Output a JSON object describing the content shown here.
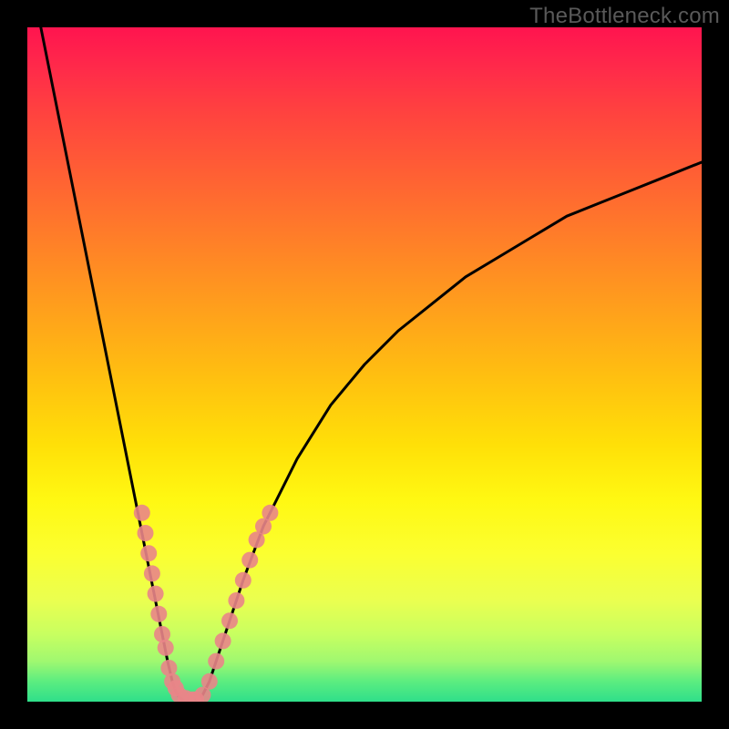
{
  "attribution": "TheBottleneck.com",
  "colors": {
    "frame": "#000000",
    "curve": "#000000",
    "markers": "#e98588",
    "gradient_top": "#ff144f",
    "gradient_bottom": "#2fdf8a"
  },
  "chart_data": {
    "type": "line",
    "title": "",
    "xlabel": "",
    "ylabel": "",
    "xlim": [
      0,
      100
    ],
    "ylim": [
      0,
      100
    ],
    "grid": false,
    "note": "V-shaped bottleneck curve; left branch falls steeply from y≈100 at x≈2 to x≈22,y≈0; right branch rises with decreasing slope from x≈25,y≈0 toward x≈100,y≈80. Marker clusters sit near the trough of the V at roughly y 0–30 on both branches.",
    "series": [
      {
        "name": "left-branch",
        "x": [
          2,
          4,
          6,
          8,
          10,
          12,
          14,
          16,
          17,
          18,
          19,
          20,
          20.8,
          21.5,
          22,
          22.5,
          23
        ],
        "y": [
          100,
          90,
          80,
          70,
          60,
          50,
          40,
          30,
          25,
          20,
          15,
          10,
          6,
          3,
          1.5,
          0.7,
          0.3
        ]
      },
      {
        "name": "right-branch",
        "x": [
          25,
          26,
          27,
          28,
          30,
          32,
          35,
          40,
          45,
          50,
          55,
          60,
          65,
          70,
          75,
          80,
          85,
          90,
          95,
          100
        ],
        "y": [
          0.3,
          1,
          3,
          6,
          12,
          18,
          26,
          36,
          44,
          50,
          55,
          59,
          63,
          66,
          69,
          72,
          74,
          76,
          78,
          80
        ]
      }
    ],
    "markers": {
      "name": "highlighted-points",
      "color": "#e98588",
      "points": [
        {
          "x": 17.0,
          "y": 28
        },
        {
          "x": 17.5,
          "y": 25
        },
        {
          "x": 18.0,
          "y": 22
        },
        {
          "x": 18.5,
          "y": 19
        },
        {
          "x": 19.0,
          "y": 16
        },
        {
          "x": 19.5,
          "y": 13
        },
        {
          "x": 20.0,
          "y": 10
        },
        {
          "x": 20.5,
          "y": 8
        },
        {
          "x": 21.0,
          "y": 5
        },
        {
          "x": 21.5,
          "y": 3
        },
        {
          "x": 22.0,
          "y": 2
        },
        {
          "x": 22.5,
          "y": 1
        },
        {
          "x": 23.5,
          "y": 0.5
        },
        {
          "x": 24.5,
          "y": 0.3
        },
        {
          "x": 25.0,
          "y": 0.3
        },
        {
          "x": 26.0,
          "y": 1
        },
        {
          "x": 27.0,
          "y": 3
        },
        {
          "x": 28.0,
          "y": 6
        },
        {
          "x": 29.0,
          "y": 9
        },
        {
          "x": 30.0,
          "y": 12
        },
        {
          "x": 31.0,
          "y": 15
        },
        {
          "x": 32.0,
          "y": 18
        },
        {
          "x": 33.0,
          "y": 21
        },
        {
          "x": 34.0,
          "y": 24
        },
        {
          "x": 35.0,
          "y": 26
        },
        {
          "x": 36.0,
          "y": 28
        }
      ]
    }
  }
}
